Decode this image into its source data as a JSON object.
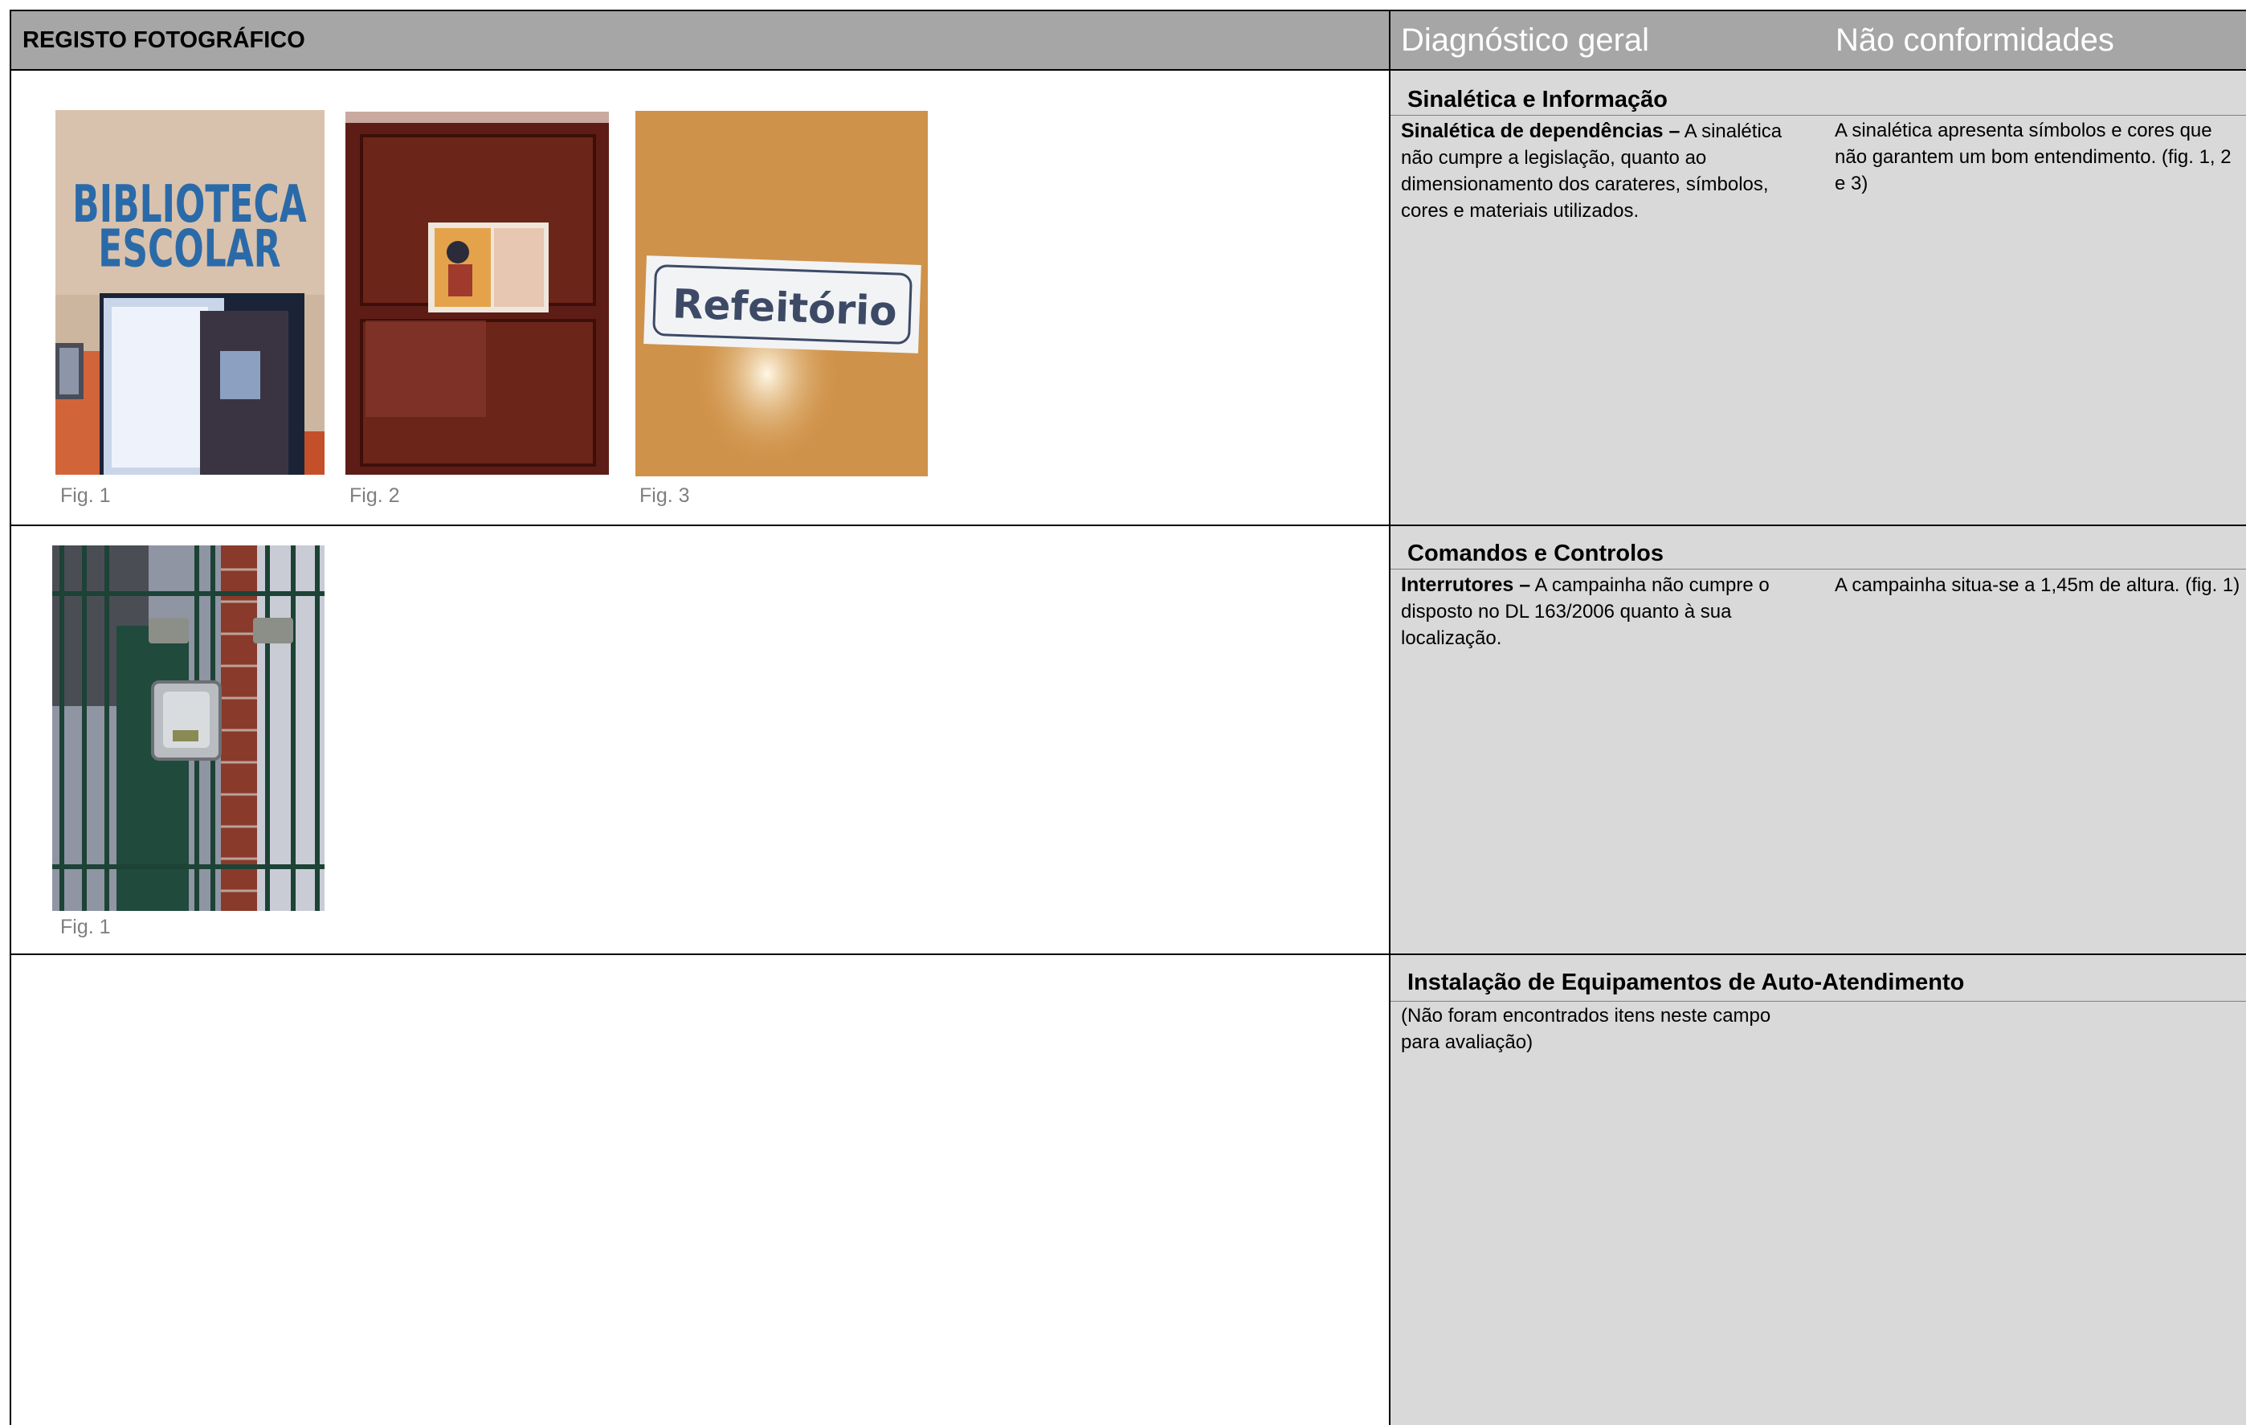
{
  "header": {
    "left_title": "REGISTO FOTOGRÁFICO",
    "col_diagnostico": "Diagnóstico geral",
    "col_nao_conformidades": "Não conformidades"
  },
  "sections": [
    {
      "title": "Sinalética e Informação",
      "diag_label": "Sinalética de dependências –",
      "diag_text": " A sinalética não cumpre a legislação, quanto ao dimensionamento dos carateres, símbolos, cores e materiais utilizados.",
      "nao_conformidade": "A sinalética apresenta símbolos e cores que não garantem um bom entendimento. (fig. 1, 2 e 3)",
      "figures": [
        {
          "caption": "Fig. 1",
          "sign_line1": "BIBLIOTECA",
          "sign_line2": "ESCOLAR"
        },
        {
          "caption": "Fig. 2"
        },
        {
          "caption": "Fig. 3",
          "sign_text": "Refeitório"
        }
      ]
    },
    {
      "title": "Comandos e Controlos",
      "diag_label": "Interrutores –",
      "diag_text": " A campainha não cumpre o disposto no DL 163/2006 quanto à sua localização.",
      "nao_conformidade": "A campainha situa-se a 1,45m de altura. (fig. 1)",
      "figures": [
        {
          "caption": "Fig. 1"
        }
      ]
    },
    {
      "title": "Instalação de Equipamentos de Auto-Atendimento",
      "diag_text": "(Não foram encontrados itens neste campo para avaliação)"
    }
  ],
  "colors": {
    "header_bg": "#a6a6a6",
    "panel_bg": "#d9d9d9",
    "caption": "#7f7f7f"
  }
}
